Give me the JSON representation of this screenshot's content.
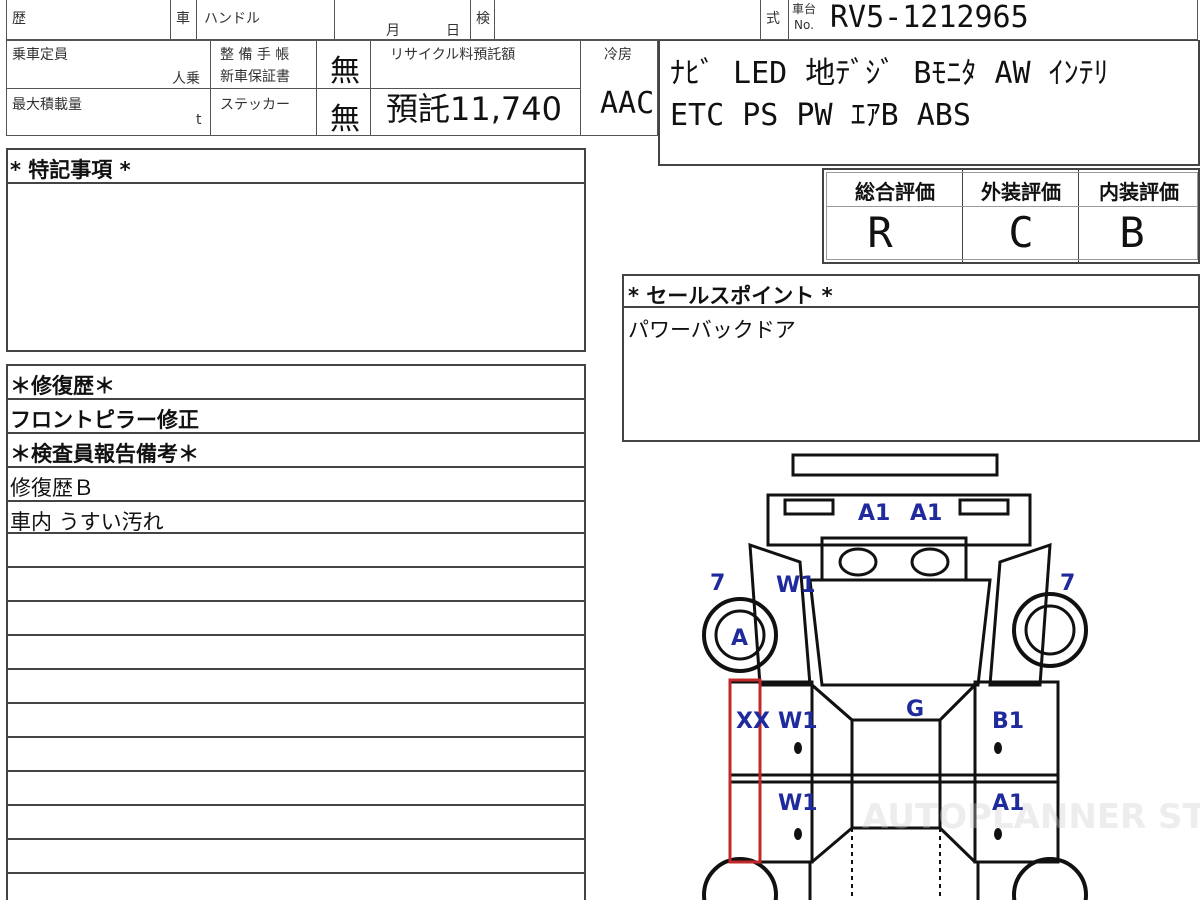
{
  "header": {
    "history_label": "歴",
    "car_label": "車",
    "handle_label": "ハンドル",
    "month_label": "月",
    "day_label": "日",
    "inspection_label": "検",
    "model_label": "式",
    "chassis_label_top": "車台",
    "chassis_label_no": "No.",
    "chassis_no": "RV5-1212965"
  },
  "row2": {
    "capacity_label": "乗車定員",
    "capacity_unit": "人乗",
    "maintenance_label": "整 備 手 帳",
    "warranty_label": "新車保証書",
    "maintenance_value": "無",
    "recycle_label": "リサイクル料預託額",
    "recycle_value": "預託11,740",
    "aircon_label": "冷房",
    "aircon_value": "AAC",
    "max_load_label": "最大積載量",
    "max_load_unit": "t",
    "sticker_label": "ステッカー",
    "sticker_value": "無"
  },
  "equipment": {
    "line1": "ﾅﾋﾞ LED 地ﾃﾞｼﾞ Bﾓﾆﾀ AW ｲﾝﾃﾘ",
    "line2": "ETC PS PW ｴｱB ABS"
  },
  "scores": {
    "overall_label": "総合評価",
    "overall_value": "R",
    "exterior_label": "外装評価",
    "exterior_value": "C",
    "interior_label": "内装評価",
    "interior_value": "B"
  },
  "special_notes": {
    "title": "* 特記事項 *"
  },
  "sales_point": {
    "title": "* セールスポイント *",
    "text": "パワーバックドア"
  },
  "repair": {
    "title": "＊修復歴＊",
    "text": "フロントピラー修正",
    "inspector_title": "＊検査員報告備考＊",
    "line1": "修復歴Ｂ",
    "line2": "車内 うすい汚れ"
  },
  "diagram": {
    "marks": {
      "a1_left": "A1",
      "a1_right": "A1",
      "seven_left": "7",
      "seven_right": "7",
      "w1_top": "W1",
      "a_tire": "A",
      "g": "G",
      "xx": "XX",
      "w1_mid": "W1",
      "b1": "B1",
      "w1_low": "W1",
      "a1_low": "A1"
    },
    "watermark": "AUTOPLANNER STUDIO PRO"
  },
  "colors": {
    "mark_blue": "#1f2a9c",
    "highlight_red": "#c0282a",
    "border": "#444444"
  }
}
